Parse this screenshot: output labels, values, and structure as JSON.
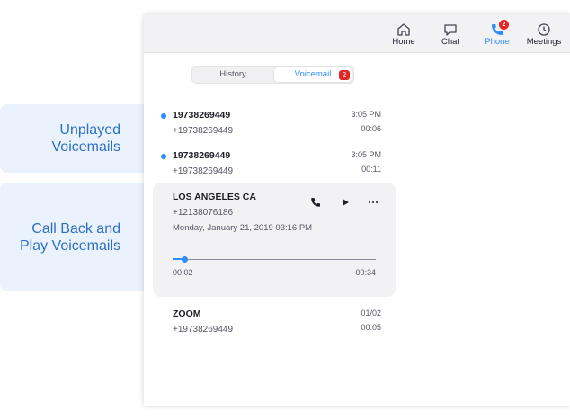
{
  "callouts": [
    {
      "line1": "Unplayed",
      "line2": "Voicemails"
    },
    {
      "line1": "Call Back and",
      "line2": "Play Voicemails"
    }
  ],
  "nav": {
    "home": {
      "label": "Home",
      "icon": "home-icon"
    },
    "chat": {
      "label": "Chat",
      "icon": "chat-icon"
    },
    "phone": {
      "label": "Phone",
      "icon": "phone-icon",
      "badge": "2"
    },
    "meetings": {
      "label": "Meetings",
      "icon": "clock-icon"
    }
  },
  "tabs": {
    "history": "History",
    "voicemail": "Voicemail",
    "voicemail_badge": "2"
  },
  "voicemails": [
    {
      "name": "19738269449",
      "number": "+19738269449",
      "time": "3:05 PM",
      "duration": "00:06",
      "unplayed": true
    },
    {
      "name": "19738269449",
      "number": "+19738269449",
      "time": "3:05 PM",
      "duration": "00:11",
      "unplayed": true
    },
    {
      "name": "LOS ANGELES  CA",
      "number": "+12138076186",
      "date": "Monday, January 21, 2019 03:16 PM",
      "elapsed": "00:02",
      "remaining": "-00:34",
      "progress": 0.06
    },
    {
      "name": "ZOOM",
      "number": "+19738269449",
      "time": "01/02",
      "duration": "00:05",
      "unplayed": false
    }
  ],
  "colors": {
    "accent": "#2d8cff",
    "badge": "#e02828",
    "callout_bg": "#e9f2fd",
    "callout_text": "#2e6fc4"
  }
}
